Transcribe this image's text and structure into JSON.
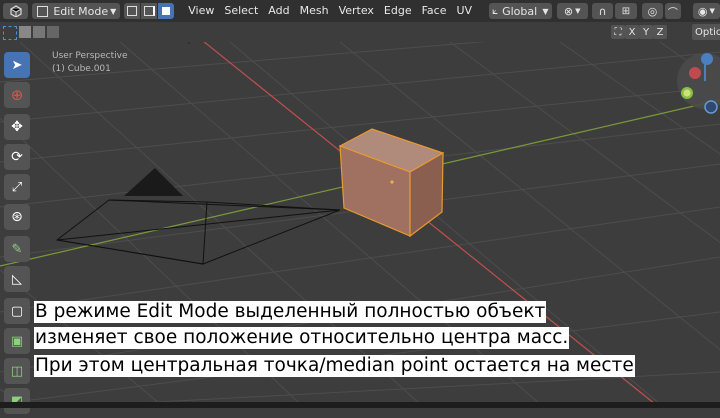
{
  "header": {
    "mode": "Edit Mode",
    "menus": [
      "View",
      "Select",
      "Add",
      "Mesh",
      "Vertex",
      "Edge",
      "Face",
      "UV"
    ],
    "orientation": "Global",
    "options_label": "Optic"
  },
  "axes": {
    "x": "X",
    "y": "Y",
    "z": "Z"
  },
  "overlay": {
    "perspective": "User Perspective",
    "object": "(1) Cube.001"
  },
  "caption": {
    "line1": "В режиме Edit Mode выделенный полностью объект",
    "line2": " изменяет свое положение относительно центра масс.",
    "line3": "При этом центральная точка/median point остается на месте"
  },
  "colors": {
    "header_bg": "#303030",
    "viewport_bg": "#3d3d3d",
    "active_tool": "#4772b3",
    "cube_outline": "#f0a030",
    "x_axis": "#c0504d",
    "y_axis": "#7a9a3a"
  },
  "icons": {
    "editor_type": "cube-icon",
    "select_modes": [
      "vertex-select-icon",
      "edge-select-icon",
      "face-select-icon"
    ],
    "tools": [
      "cursor-icon",
      "target-icon",
      "move-icon",
      "rotate-icon",
      "scale-icon",
      "transform-icon",
      "annotate-icon",
      "measure-icon",
      "add-cube-icon",
      "extrude-icon",
      "inset-icon",
      "bevel-icon"
    ]
  }
}
